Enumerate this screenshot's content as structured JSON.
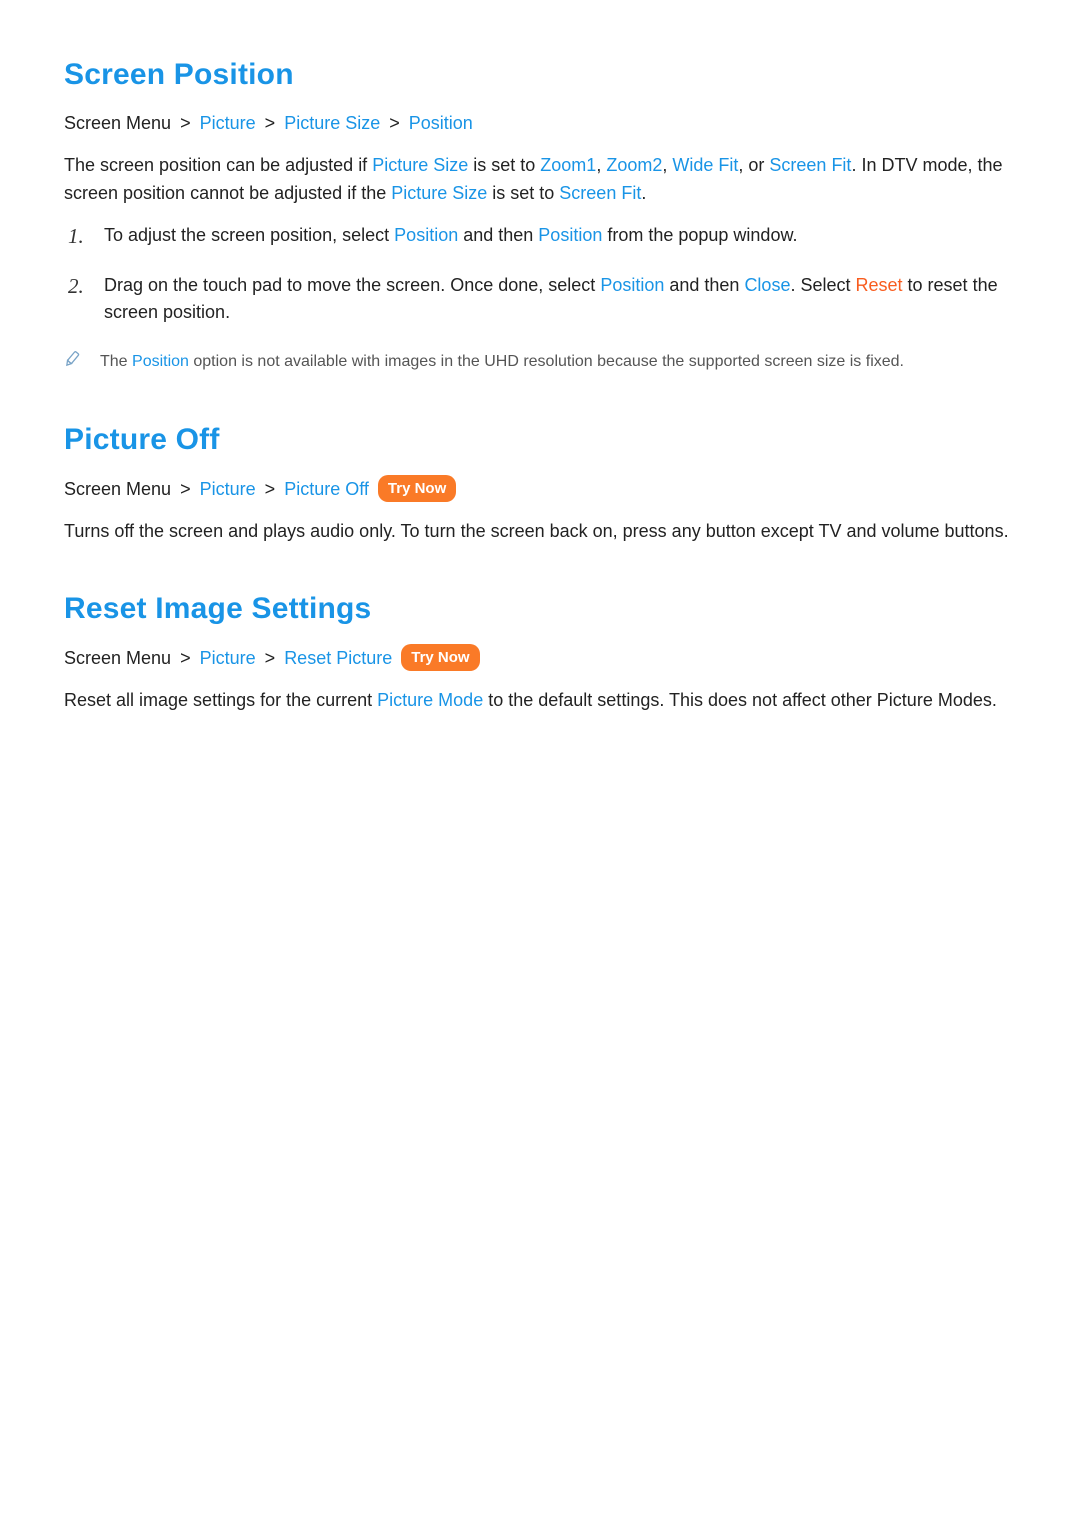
{
  "colors": {
    "heading": "#1994e6",
    "accent": "#f85c1e",
    "link": "#1994e6",
    "tryNowBg": "#fa7a27"
  },
  "labels": {
    "tryNow": "Try Now",
    "separator": ">"
  },
  "section1": {
    "title": "Screen Position",
    "crumb": {
      "a": "Screen Menu",
      "b": "Picture",
      "c": "Picture Size",
      "d": "Position"
    },
    "p1": {
      "t1": "The screen position can be adjusted if ",
      "pictureSize1": "Picture Size",
      "t2": " is set to ",
      "zoom1": "Zoom1",
      "comma1": ", ",
      "zoom2": "Zoom2",
      "comma2": ", ",
      "wideFit": "Wide Fit",
      "t3": ", or ",
      "screenFit1": "Screen Fit",
      "t4": ". In DTV mode, the screen position cannot be adjusted if the ",
      "pictureSize2": "Picture Size",
      "t5": " is set to ",
      "screenFit2": "Screen Fit",
      "t6": "."
    },
    "steps": {
      "s1": {
        "num": "1.",
        "a": "To adjust the screen position, select ",
        "pos1": "Position",
        "b": " and then ",
        "pos2": "Position",
        "c": " from the popup window."
      },
      "s2": {
        "num": "2.",
        "a": "Drag on the touch pad to move the screen. Once done, select ",
        "pos": "Position",
        "b": " and then ",
        "close": "Close",
        "c": ". Select ",
        "reset": "Reset",
        "d": " to reset the screen position."
      }
    },
    "note": {
      "a": "The ",
      "pos": "Position",
      "b": " option is not available with images in the UHD resolution because the supported screen size is fixed."
    }
  },
  "section2": {
    "title": "Picture Off",
    "crumb": {
      "a": "Screen Menu",
      "b": "Picture",
      "c": "Picture Off"
    },
    "body": "Turns off the screen and plays audio only. To turn the screen back on, press any button except TV and volume buttons."
  },
  "section3": {
    "title": "Reset Image Settings",
    "crumb": {
      "a": "Screen Menu",
      "b": "Picture",
      "c": "Reset Picture"
    },
    "body": {
      "a": "Reset all image settings for the current ",
      "pm": "Picture Mode",
      "b": " to the default settings. This does not affect other Picture Modes."
    }
  }
}
